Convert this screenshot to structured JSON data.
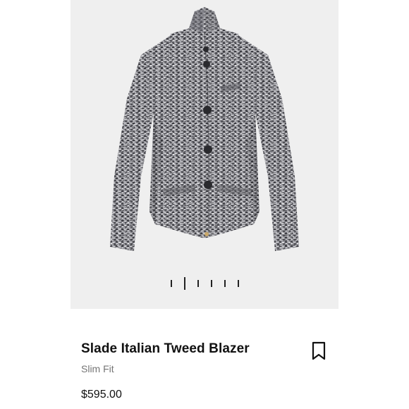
{
  "product": {
    "name": "Slade Italian Tweed Blazer",
    "fit": "Slim Fit",
    "price": "$595.00"
  },
  "gallery": {
    "image_count": 6,
    "active_index": 1,
    "background_color": "#efefef"
  },
  "icons": {
    "save": "bookmark-icon"
  },
  "colors": {
    "text_primary": "#111111",
    "text_secondary": "#757575",
    "tweed_base": "#8a8a8e",
    "button": "#2a2a2e"
  }
}
